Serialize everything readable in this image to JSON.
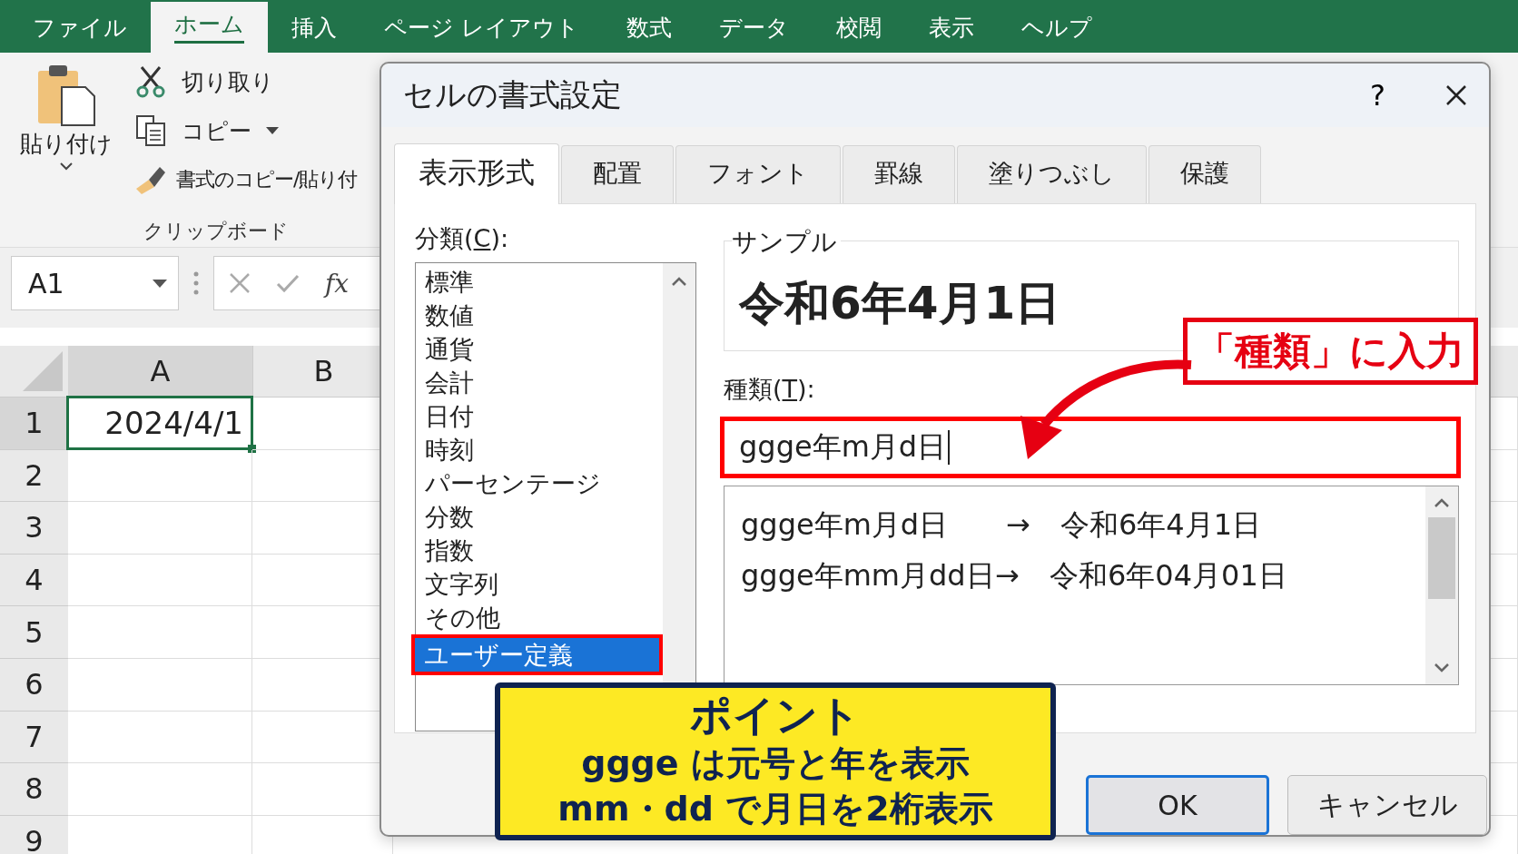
{
  "ribbon_tabs": [
    {
      "label": "ファイル",
      "selected": false
    },
    {
      "label": "ホーム",
      "selected": true
    },
    {
      "label": "挿入",
      "selected": false
    },
    {
      "label": "ページ レイアウト",
      "selected": false
    },
    {
      "label": "数式",
      "selected": false
    },
    {
      "label": "データ",
      "selected": false
    },
    {
      "label": "校閲",
      "selected": false
    },
    {
      "label": "表示",
      "selected": false
    },
    {
      "label": "ヘルプ",
      "selected": false
    }
  ],
  "clipboard": {
    "paste": "貼り付け",
    "cut": "切り取り",
    "copy": "コピー",
    "format_painter": "書式のコピー/貼り付",
    "group_label": "クリップボード"
  },
  "formula_bar": {
    "name_box": "A1",
    "fx": "fx"
  },
  "sheet": {
    "columns": [
      "A",
      "B"
    ],
    "rows": [
      "1",
      "2",
      "3",
      "4",
      "5",
      "6",
      "7",
      "8",
      "9"
    ],
    "active_cell": "2024/4/1"
  },
  "dialog": {
    "title": "セルの書式設定",
    "help": "?",
    "tabs": [
      {
        "label": "表示形式",
        "selected": true
      },
      {
        "label": "配置",
        "selected": false
      },
      {
        "label": "フォント",
        "selected": false
      },
      {
        "label": "罫線",
        "selected": false
      },
      {
        "label": "塗りつぶし",
        "selected": false
      },
      {
        "label": "保護",
        "selected": false
      }
    ],
    "category_label": {
      "before": "分類(",
      "key": "C",
      "after": "):"
    },
    "categories": [
      {
        "label": "標準",
        "selected": false
      },
      {
        "label": "数値",
        "selected": false
      },
      {
        "label": "通貨",
        "selected": false
      },
      {
        "label": "会計",
        "selected": false
      },
      {
        "label": "日付",
        "selected": false
      },
      {
        "label": "時刻",
        "selected": false
      },
      {
        "label": "パーセンテージ",
        "selected": false
      },
      {
        "label": "分数",
        "selected": false
      },
      {
        "label": "指数",
        "selected": false
      },
      {
        "label": "文字列",
        "selected": false
      },
      {
        "label": "その他",
        "selected": false
      },
      {
        "label": "ユーザー定義",
        "selected": true
      }
    ],
    "sample_label": "サンプル",
    "sample_value": "令和6年4月1日",
    "type_label": {
      "before": "種類(",
      "key": "T",
      "after": "):"
    },
    "type_value": "ggge年m月d日",
    "formats": [
      {
        "code": "ggge年m月d日",
        "arrow": "→",
        "result": "令和6年4月1日"
      },
      {
        "code": "ggge年mm月dd日",
        "arrow": "→",
        "result": "令和6年04月01日"
      }
    ],
    "buttons": [
      "OK",
      "キャンセル"
    ]
  },
  "annotations": {
    "callout": "「種類」に入力",
    "point_title": "ポイント",
    "point_lines": [
      "ggge は元号と年を表示",
      "mm・dd で月日を2桁表示"
    ]
  }
}
